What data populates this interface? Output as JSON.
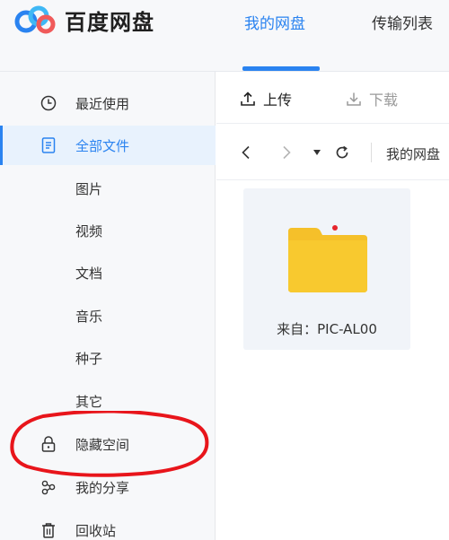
{
  "app": {
    "name": "百度网盘"
  },
  "top_tabs": [
    {
      "label": "我的网盘",
      "active": true
    },
    {
      "label": "传输列表",
      "active": false
    }
  ],
  "sidebar": {
    "items": [
      {
        "label": "最近使用",
        "icon": "clock-icon"
      },
      {
        "label": "全部文件",
        "icon": "document-icon",
        "active": true
      },
      {
        "label": "图片"
      },
      {
        "label": "视频"
      },
      {
        "label": "文档"
      },
      {
        "label": "音乐"
      },
      {
        "label": "种子"
      },
      {
        "label": "其它"
      },
      {
        "label": "隐藏空间",
        "icon": "lock-icon"
      },
      {
        "label": "我的分享",
        "icon": "share-icon"
      },
      {
        "label": "回收站",
        "icon": "trash-icon"
      }
    ]
  },
  "toolbar": {
    "upload_label": "上传",
    "download_label": "下载"
  },
  "breadcrumb": {
    "current": "我的网盘"
  },
  "files": [
    {
      "name": "来自：PIC-AL00",
      "type": "folder"
    }
  ],
  "colors": {
    "accent": "#2a83f0",
    "folder": "#f7c52b",
    "annotation": "#e8151b"
  }
}
